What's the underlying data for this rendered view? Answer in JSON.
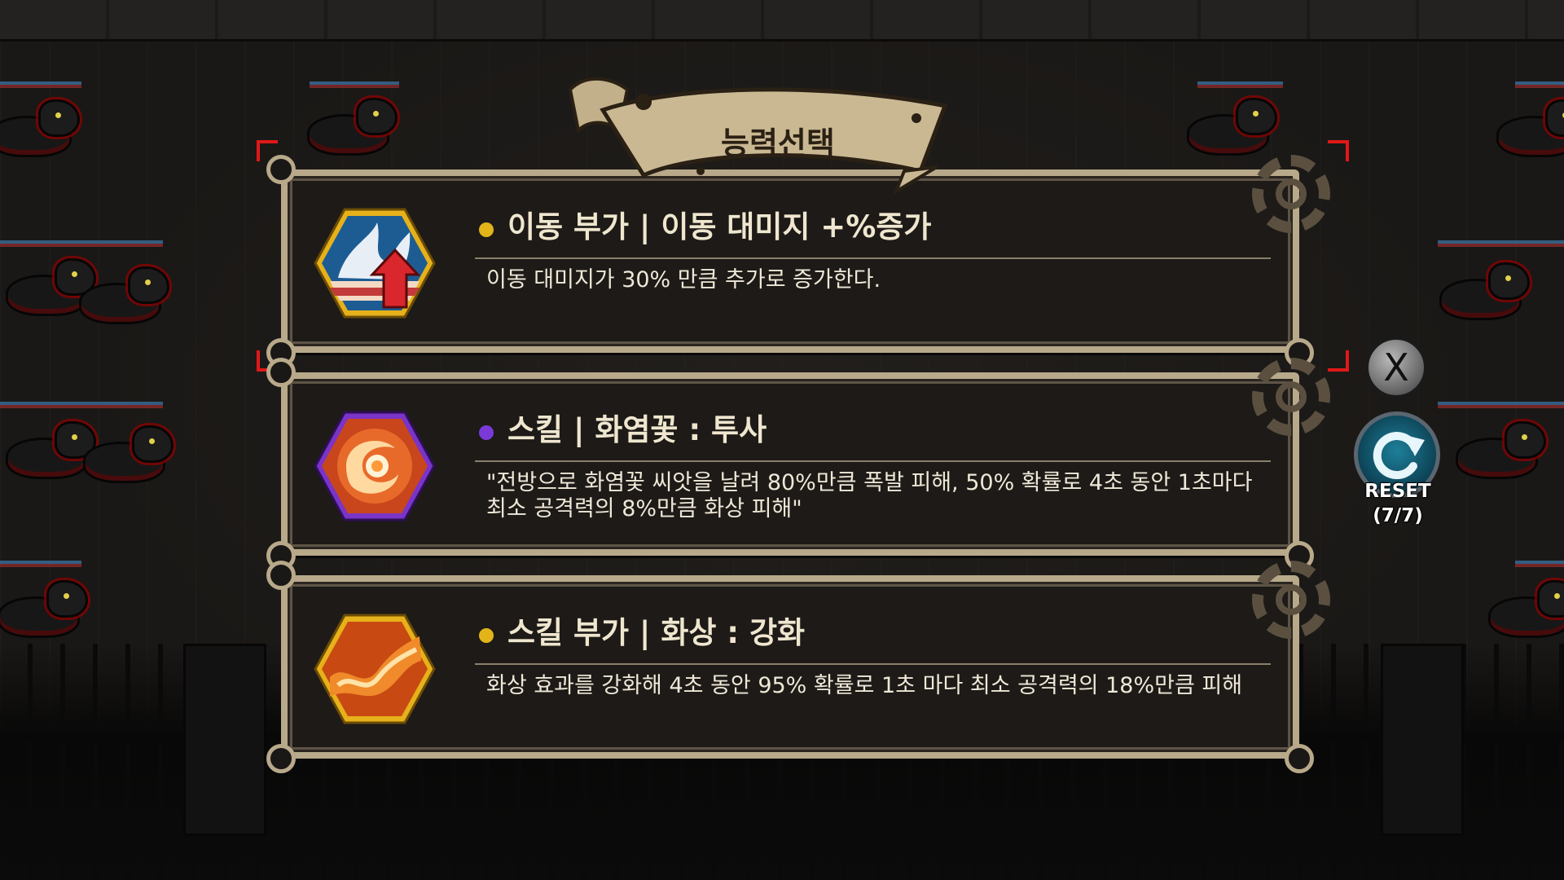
{
  "window": {
    "title": "능력선택"
  },
  "colors": {
    "frame": "#b8a98a",
    "panel_bg": "#1d1a17",
    "title_text": "#efe6cf",
    "bullet_gold": "#e2b41a",
    "bullet_purple": "#7a3ad8"
  },
  "abilities": [
    {
      "icon": "move-damage-wave-up-icon",
      "bullet": "gold",
      "title": "이동 부가 | 이동 대미지 +%증가",
      "description": "이동 대미지가 30% 만큼 추가로 증가한다."
    },
    {
      "icon": "fire-spark-swirl-icon",
      "bullet": "purple",
      "title": "스킬 | 화염꽃 : 투사",
      "description": "\"전방으로 화염꽃 씨앗을 날려 80%만큼 폭발 피해, 50% 확률로 4초 동안 1초마다 최소 공격력의 8%만큼 화상 피해\""
    },
    {
      "icon": "burn-enhance-icon",
      "bullet": "gold",
      "title": "스킬 부가 | 화상 : 강화",
      "description": "화상 효과를 강화해 4초 동안 95% 확률로 1초 마다 최소 공격력의 18%만큼 피해"
    }
  ],
  "controls": {
    "close_label": "X",
    "reset_label": "RESET",
    "reset_count": "(7/7)"
  }
}
